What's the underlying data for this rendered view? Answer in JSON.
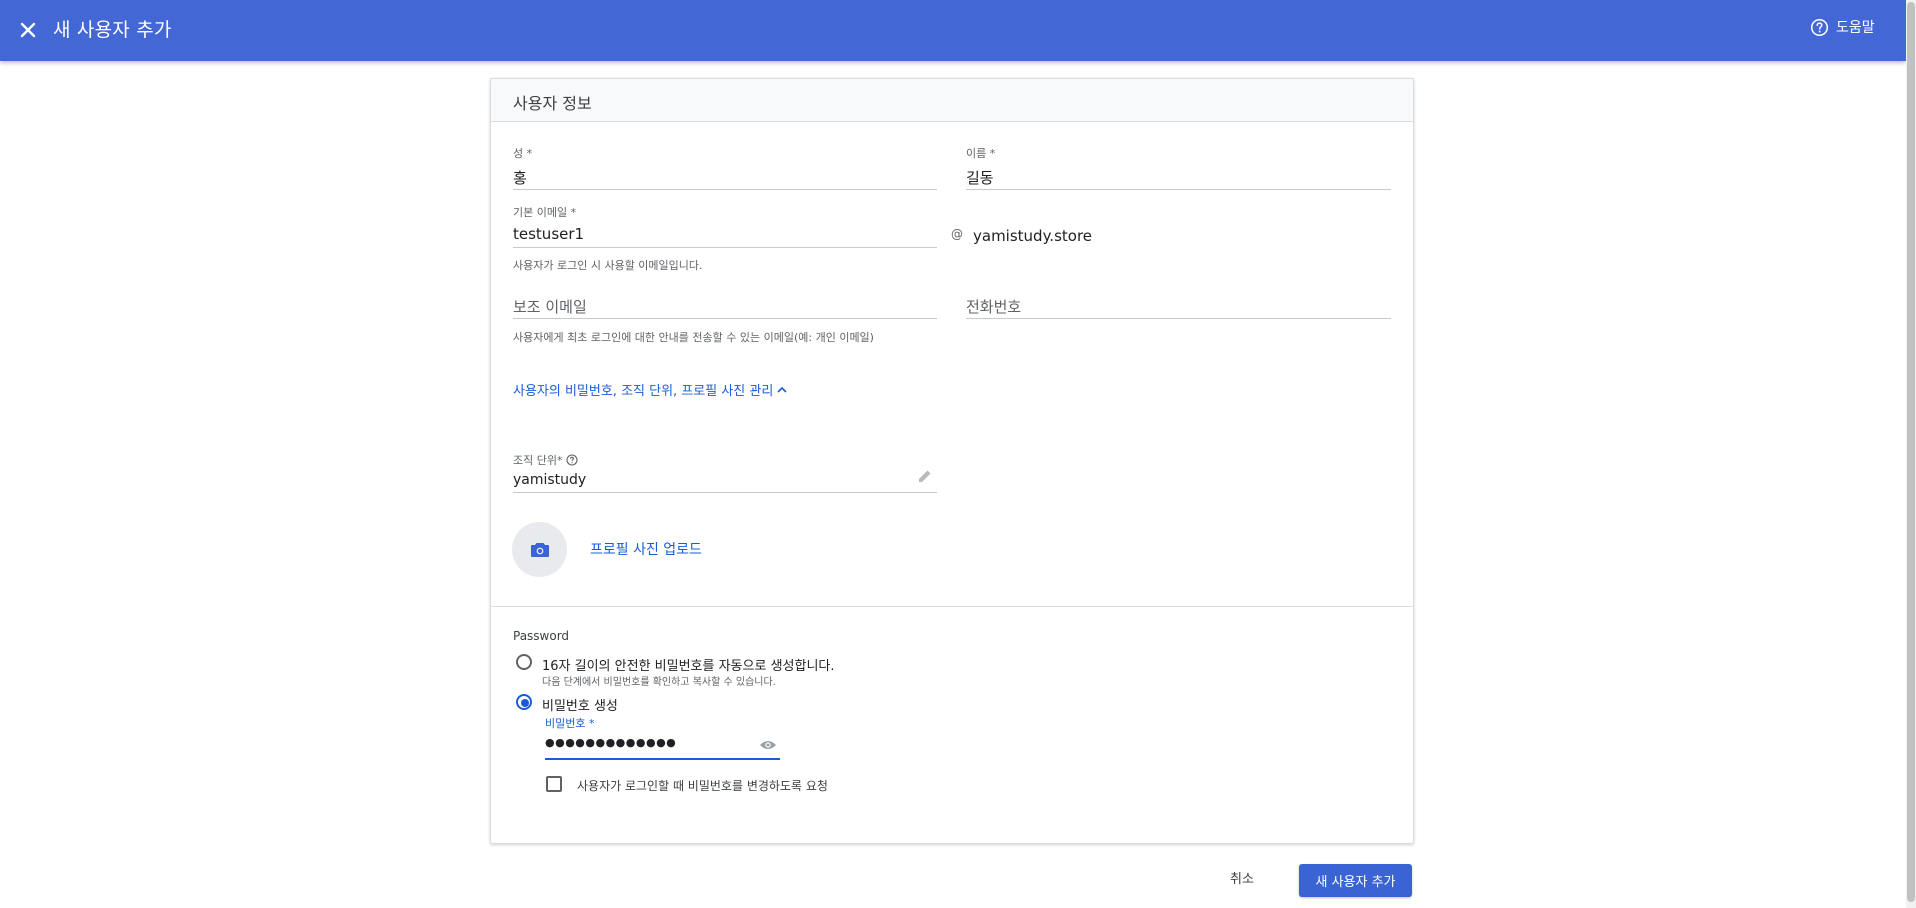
{
  "header": {
    "title": "새 사용자 추가",
    "help_label": "도움말"
  },
  "card": {
    "section_title": "사용자 정보",
    "last_name": {
      "label": "성 *",
      "value": "홍"
    },
    "first_name": {
      "label": "이름 *",
      "value": "길동"
    },
    "primary_email": {
      "label": "기본 이메일 *",
      "value": "testuser1",
      "at": "@",
      "domain": "yamistudy.store",
      "hint": "사용자가 로그인 시 사용할 이메일입니다."
    },
    "secondary_email": {
      "placeholder": "보조 이메일",
      "hint": "사용자에게 최초 로그인에 대한 안내를 전송할 수 있는 이메일(예: 개인 이메일)"
    },
    "phone": {
      "placeholder": "전화번호"
    },
    "manage_link": "사용자의 비밀번호, 조직 단위, 프로필 사진 관리",
    "org_unit": {
      "label": "조직 단위*",
      "value": "yamistudy"
    },
    "profile_upload": "프로필 사진 업로드",
    "password": {
      "section_label": "Password",
      "option_auto": "16자 길이의 안전한 비밀번호를 자동으로 생성합니다.",
      "option_auto_hint": "다음 단계에서 비밀번호를 확인하고 복사할 수 있습니다.",
      "option_manual": "비밀번호 생성",
      "selected_option": "manual",
      "field_label": "비밀번호 *",
      "masked_value": "●●●●●●●●●●●●●",
      "require_change_label": "사용자가 로그인할 때 비밀번호를 변경하도록 요청",
      "require_change_checked": false
    }
  },
  "footer": {
    "cancel_label": "취소",
    "submit_label": "새 사용자 추가"
  },
  "colors": {
    "brand": "#4467d6",
    "accent": "#1a5cd7",
    "primary_button": "#3a63d4"
  }
}
